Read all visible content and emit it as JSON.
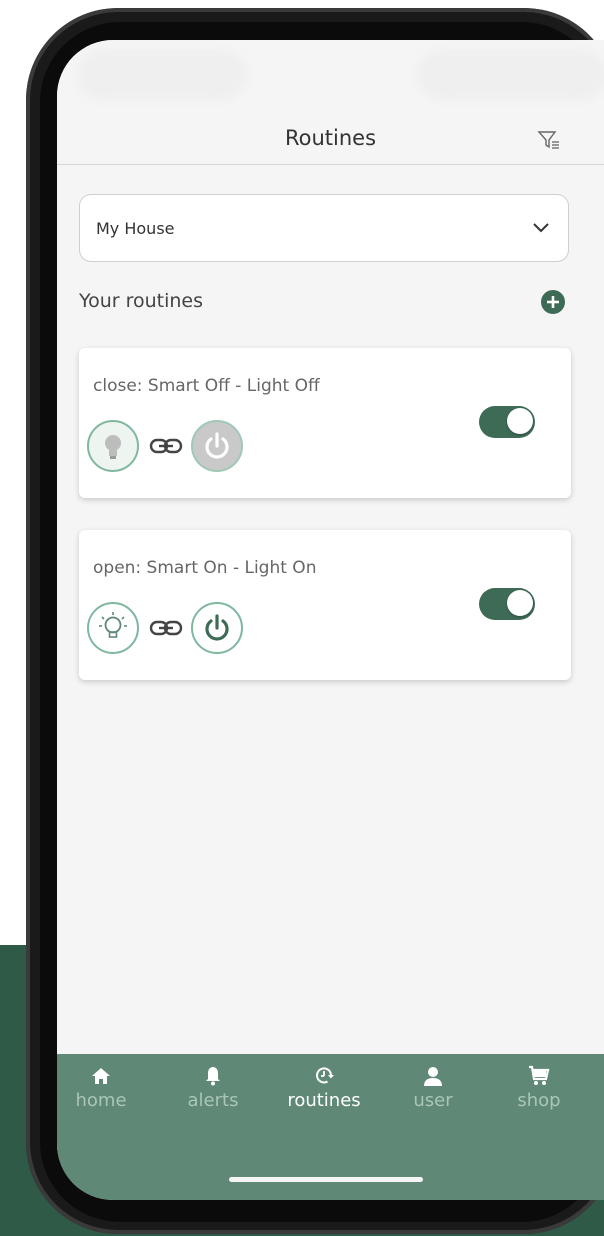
{
  "header": {
    "title": "Routines"
  },
  "house_select": {
    "value": "My House"
  },
  "routines_section": {
    "title": "Your routines"
  },
  "routines": [
    {
      "title": "close: Smart Off - Light Off",
      "state": "off",
      "enabled": true
    },
    {
      "title": "open: Smart On - Light On",
      "state": "on",
      "enabled": true
    }
  ],
  "nav": {
    "items": [
      {
        "label": "home",
        "icon": "home-icon",
        "active": false
      },
      {
        "label": "alerts",
        "icon": "bell-icon",
        "active": false
      },
      {
        "label": "routines",
        "icon": "routine-clock-icon",
        "active": true
      },
      {
        "label": "user",
        "icon": "user-icon",
        "active": false
      },
      {
        "label": "shop",
        "icon": "cart-icon",
        "active": false
      }
    ]
  },
  "colors": {
    "accent": "#3e6b56",
    "nav_bg": "#5f8877",
    "icon_green": "#7fb89f",
    "bg_accent": "#2f5a48"
  }
}
